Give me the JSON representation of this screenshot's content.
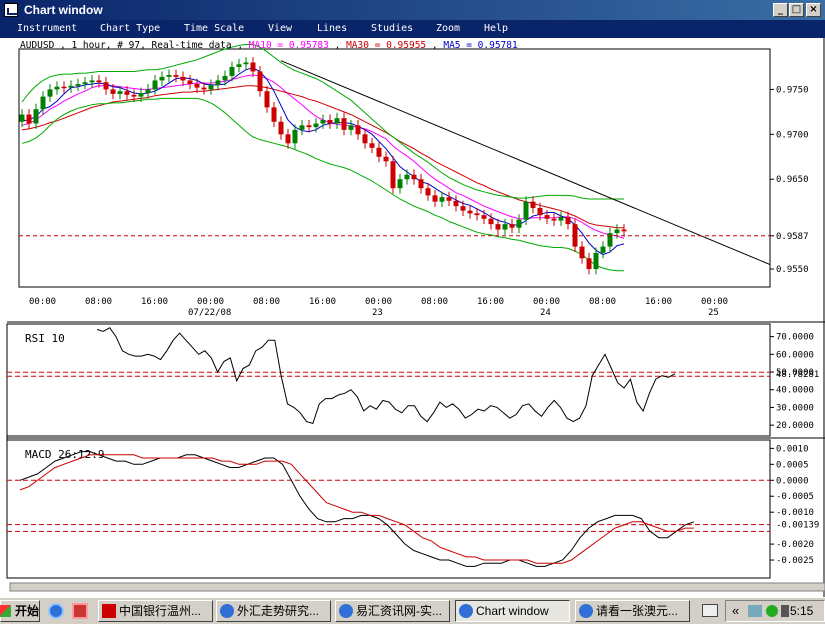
{
  "window": {
    "title": "Chart window"
  },
  "title_buttons": {
    "minimize": "_",
    "maximize": "□",
    "close": "×"
  },
  "menu": [
    "Instrument",
    "Chart Type",
    "Time Scale",
    "View",
    "Lines",
    "Studies",
    "Zoom",
    "Help"
  ],
  "info": {
    "symbol": "AUDUSD , 1 hour, # 97, Real-time data ,",
    "ma10": "MA10 = 0.95783",
    "ma30": "MA30 = 0.95955",
    "ma5": "MA5 = 0.95781",
    "sep": ","
  },
  "colors": {
    "ma10": "#ff00ff",
    "ma30": "#cc0000",
    "ma5": "#0000cc",
    "bollinger": "#00aa00",
    "up": "#008000",
    "down": "#cc0000"
  },
  "time_axis": {
    "labels": [
      "00:00",
      "08:00",
      "16:00",
      "00:00",
      "08:00",
      "16:00",
      "00:00",
      "08:00",
      "16:00",
      "00:00",
      "08:00",
      "16:00",
      "00:00"
    ],
    "dates": [
      "07/22/08",
      "23",
      "24",
      "25"
    ]
  },
  "chart_data": [
    {
      "type": "candlestick",
      "title": "AUDUSD , 1 hour",
      "y_ticks": [
        "0.9750",
        "0.9700",
        "0.9650",
        "0.9550"
      ],
      "ylim": [
        0.953,
        0.9795
      ],
      "current_price": "0.9587",
      "grid": false,
      "closes": [
        0.9722,
        0.9712,
        0.9728,
        0.9742,
        0.975,
        0.9753,
        0.9752,
        0.9754,
        0.9756,
        0.9758,
        0.976,
        0.9758,
        0.975,
        0.9745,
        0.9748,
        0.9744,
        0.9742,
        0.9746,
        0.975,
        0.976,
        0.9764,
        0.9766,
        0.9764,
        0.976,
        0.9756,
        0.9752,
        0.975,
        0.9755,
        0.976,
        0.9765,
        0.9775,
        0.9778,
        0.978,
        0.977,
        0.9748,
        0.973,
        0.9714,
        0.97,
        0.969,
        0.9705,
        0.971,
        0.9708,
        0.9712,
        0.9716,
        0.9712,
        0.9718,
        0.9705,
        0.971,
        0.97,
        0.969,
        0.9685,
        0.9675,
        0.967,
        0.964,
        0.965,
        0.9655,
        0.965,
        0.964,
        0.9632,
        0.9625,
        0.963,
        0.9626,
        0.962,
        0.9615,
        0.9612,
        0.961,
        0.9606,
        0.96,
        0.9594,
        0.96,
        0.9596,
        0.9605,
        0.9625,
        0.9618,
        0.961,
        0.9606,
        0.9604,
        0.9608,
        0.96,
        0.9575,
        0.9562,
        0.955,
        0.9568,
        0.9575,
        0.959,
        0.9594,
        0.9592
      ],
      "series": [
        {
          "name": "MA10",
          "color": "#ff00ff",
          "values": [
            0.971,
            0.9712,
            0.9716,
            0.9722,
            0.9728,
            0.9732,
            0.9737,
            0.9741,
            0.9745,
            0.9748,
            0.9752,
            0.9754,
            0.9754,
            0.9754,
            0.9753,
            0.9752,
            0.9751,
            0.975,
            0.975,
            0.9751,
            0.9752,
            0.9753,
            0.9754,
            0.9755,
            0.9756,
            0.9757,
            0.9757,
            0.9757,
            0.9758,
            0.9759,
            0.9761,
            0.9763,
            0.9765,
            0.9766,
            0.9765,
            0.9762,
            0.9758,
            0.9752,
            0.9745,
            0.9739,
            0.9733,
            0.9726,
            0.972,
            0.9716,
            0.9713,
            0.9711,
            0.971,
            0.9709,
            0.9708,
            0.9706,
            0.9703,
            0.9699,
            0.9695,
            0.9687,
            0.9681,
            0.9676,
            0.967,
            0.9663,
            0.9656,
            0.965,
            0.9645,
            0.964,
            0.9635,
            0.9632,
            0.9628,
            0.9624,
            0.962,
            0.9617,
            0.9614,
            0.9611,
            0.9608,
            0.9606,
            0.9606,
            0.9607,
            0.9607,
            0.9607,
            0.9607,
            0.9608,
            0.9608,
            0.9606,
            0.9602,
            0.9597,
            0.9593,
            0.959,
            0.9588,
            0.9587,
            0.9584
          ]
        },
        {
          "name": "MA30",
          "color": "#cc0000",
          "values": [
            0.9705,
            0.9706,
            0.9708,
            0.971,
            0.9713,
            0.9715,
            0.9718,
            0.9721,
            0.9724,
            0.9727,
            0.973,
            0.9732,
            0.9734,
            0.9736,
            0.9737,
            0.9738,
            0.9739,
            0.974,
            0.9741,
            0.9743,
            0.9744,
            0.9745,
            0.9746,
            0.9747,
            0.9747,
            0.9748,
            0.9748,
            0.9749,
            0.975,
            0.9751,
            0.9752,
            0.9753,
            0.9754,
            0.9754,
            0.9753,
            0.9752,
            0.975,
            0.9748,
            0.9746,
            0.9744,
            0.9742,
            0.9739,
            0.9737,
            0.9734,
            0.9731,
            0.9728,
            0.9725,
            0.9722,
            0.9718,
            0.9714,
            0.971,
            0.9706,
            0.9702,
            0.9697,
            0.9692,
            0.9688,
            0.9684,
            0.9679,
            0.9675,
            0.967,
            0.9666,
            0.9662,
            0.9658,
            0.9654,
            0.965,
            0.9646,
            0.9643,
            0.9639,
            0.9636,
            0.9633,
            0.963,
            0.9627,
            0.9625,
            0.9623,
            0.9621,
            0.9619,
            0.9617,
            0.9615,
            0.9612,
            0.9609,
            0.9605,
            0.9601,
            0.9599,
            0.9598,
            0.9597,
            0.9596,
            0.9596
          ]
        },
        {
          "name": "MA5",
          "color": "#0000cc",
          "values": [
            0.9715,
            0.9716,
            0.972,
            0.9728,
            0.9731,
            0.9737,
            0.9745,
            0.9752,
            0.9753,
            0.9755,
            0.9756,
            0.9757,
            0.9756,
            0.9753,
            0.9752,
            0.9749,
            0.9746,
            0.9745,
            0.9746,
            0.9748,
            0.9752,
            0.9757,
            0.9762,
            0.9763,
            0.9762,
            0.976,
            0.9756,
            0.9755,
            0.9755,
            0.9756,
            0.9761,
            0.9767,
            0.9772,
            0.9774,
            0.977,
            0.9761,
            0.9748,
            0.9732,
            0.9716,
            0.9708,
            0.9704,
            0.9703,
            0.9705,
            0.971,
            0.9712,
            0.9713,
            0.9713,
            0.9712,
            0.9709,
            0.9705,
            0.97,
            0.9692,
            0.9684,
            0.9674,
            0.9664,
            0.9658,
            0.9653,
            0.9647,
            0.9645,
            0.964,
            0.9635,
            0.9631,
            0.9627,
            0.9623,
            0.9621,
            0.9617,
            0.9613,
            0.9608,
            0.9604,
            0.9602,
            0.9599,
            0.9599,
            0.9604,
            0.9609,
            0.9611,
            0.9613,
            0.9613,
            0.9609,
            0.9606,
            0.9599,
            0.959,
            0.9579,
            0.9571,
            0.9566,
            0.9569,
            0.9576,
            0.9578
          ]
        },
        {
          "name": "Bollinger upper",
          "color": "#00aa00",
          "values": [
            0.9736,
            0.9746,
            0.9754,
            0.976,
            0.9764,
            0.9766,
            0.9767,
            0.9767,
            0.9768,
            0.9768,
            0.9769,
            0.977,
            0.977,
            0.977,
            0.977,
            0.977,
            0.977,
            0.9771,
            0.9772,
            0.9772,
            0.9773,
            0.9775,
            0.9777,
            0.9779,
            0.9781,
            0.9783,
            0.9786,
            0.9789,
            0.9792,
            0.9795,
            0.9797,
            0.9799,
            0.98,
            0.98,
            0.9797,
            0.9792,
            0.9786,
            0.978,
            0.9775,
            0.9771,
            0.9768,
            0.9765,
            0.9762,
            0.9758,
            0.9753,
            0.9748,
            0.9743,
            0.9738,
            0.9731,
            0.9724,
            0.9717,
            0.971,
            0.9703,
            0.9697,
            0.9691,
            0.9685,
            0.9679,
            0.9674,
            0.9669,
            0.9663,
            0.9657,
            0.9652,
            0.9648,
            0.9644,
            0.9641,
            0.9638,
            0.9636,
            0.9634,
            0.9632,
            0.9631,
            0.963,
            0.9629,
            0.9629,
            0.963,
            0.9631,
            0.9632,
            0.9632,
            0.9632,
            0.9632,
            0.9631,
            0.9629,
            0.9628,
            0.9628,
            0.9628,
            0.9628,
            0.9628,
            0.9628
          ]
        },
        {
          "name": "Bollinger lower",
          "color": "#00aa00",
          "values": [
            0.969,
            0.9692,
            0.9696,
            0.9702,
            0.971,
            0.9717,
            0.9722,
            0.9726,
            0.9729,
            0.9731,
            0.9733,
            0.9734,
            0.9734,
            0.9735,
            0.9735,
            0.9736,
            0.9737,
            0.9738,
            0.9739,
            0.9739,
            0.974,
            0.974,
            0.974,
            0.974,
            0.974,
            0.974,
            0.9738,
            0.9735,
            0.973,
            0.9724,
            0.9717,
            0.971,
            0.9703,
            0.9697,
            0.9694,
            0.9692,
            0.969,
            0.9688,
            0.9686,
            0.9683,
            0.968,
            0.9677,
            0.9673,
            0.967,
            0.9667,
            0.9665,
            0.9663,
            0.966,
            0.9656,
            0.9652,
            0.9648,
            0.9643,
            0.9638,
            0.9633,
            0.9628,
            0.9624,
            0.962,
            0.9617,
            0.9614,
            0.961,
            0.9607,
            0.9603,
            0.96,
            0.9597,
            0.9594,
            0.9591,
            0.9589,
            0.9588,
            0.9586,
            0.9585,
            0.9583,
            0.9582,
            0.958,
            0.9578,
            0.9576,
            0.9575,
            0.9574,
            0.9574,
            0.9573,
            0.957,
            0.9566,
            0.956,
            0.9554,
            0.9551,
            0.9549,
            0.9548,
            0.9548
          ]
        }
      ]
    },
    {
      "type": "line",
      "title": "RSI 10",
      "y_ticks": [
        "70.0000",
        "60.0000",
        "50.0000",
        "40.0000",
        "30.0000",
        "20.0000"
      ],
      "ylim": [
        15,
        76
      ],
      "current_value": "48.78281",
      "series": [
        {
          "name": "RSI 10",
          "color": "#000000",
          "values": [
            74,
            73,
            75,
            70,
            62,
            60,
            59,
            59,
            60,
            59,
            57,
            62,
            68,
            72,
            68,
            64,
            60,
            62,
            58,
            50,
            56,
            58,
            45,
            52,
            54,
            62,
            64,
            68,
            68,
            48,
            32,
            30,
            27,
            22,
            21,
            32,
            35,
            35,
            37,
            38,
            40,
            36,
            28,
            31,
            29,
            34,
            33,
            29,
            27,
            31,
            31,
            25,
            22,
            27,
            33,
            30,
            32,
            29,
            24,
            26,
            29,
            28,
            31,
            30,
            27,
            24,
            26,
            31,
            32,
            28,
            25,
            30,
            34,
            30,
            24,
            22,
            24,
            31,
            48,
            54,
            60,
            52,
            44,
            41,
            46,
            33,
            28,
            38,
            46,
            48,
            47,
            49
          ]
        }
      ]
    },
    {
      "type": "line",
      "title": "MACD 26:12:9",
      "y_ticks": [
        "0.0010",
        "0.0005",
        "0.0000",
        "-0.0005",
        "-0.0010",
        "-0.0020",
        "-0.0025"
      ],
      "ylim": [
        -0.003,
        0.0012
      ],
      "current_value": "-0.00139",
      "series": [
        {
          "name": "MACD",
          "color": "#000000",
          "values": [
            0.0,
            0.0001,
            0.0002,
            0.0004,
            0.0006,
            0.0007,
            0.0008,
            0.0009,
            0.0009,
            0.0008,
            0.0007,
            0.0006,
            0.0006,
            0.0005,
            0.0005,
            0.0006,
            0.0007,
            0.0007,
            0.0007,
            0.0008,
            0.0008,
            0.0007,
            0.0006,
            0.0005,
            0.0004,
            0.0004,
            0.0005,
            0.0006,
            0.0007,
            0.0007,
            0.0005,
            0.0,
            -0.0005,
            -0.0009,
            -0.0012,
            -0.0013,
            -0.0013,
            -0.0012,
            -0.0012,
            -0.0011,
            -0.0011,
            -0.0012,
            -0.0014,
            -0.0017,
            -0.002,
            -0.0022,
            -0.0023,
            -0.0024,
            -0.0025,
            -0.0025,
            -0.0026,
            -0.0027,
            -0.0027,
            -0.0026,
            -0.0026,
            -0.0026,
            -0.0025,
            -0.0025,
            -0.0026,
            -0.0027,
            -0.0027,
            -0.0026,
            -0.0025,
            -0.0022,
            -0.0018,
            -0.0015,
            -0.0013,
            -0.0012,
            -0.0011,
            -0.0011,
            -0.0011,
            -0.0012,
            -0.0016,
            -0.0018,
            -0.0018,
            -0.0016,
            -0.0014,
            -0.0013
          ]
        },
        {
          "name": "Signal",
          "color": "#cc0000",
          "values": [
            -0.0003,
            -0.0002,
            0.0,
            0.0002,
            0.0004,
            0.0005,
            0.0006,
            0.0007,
            0.0008,
            0.0008,
            0.0008,
            0.0008,
            0.0008,
            0.0008,
            0.0007,
            0.0007,
            0.0007,
            0.0007,
            0.0007,
            0.0007,
            0.0007,
            0.0007,
            0.0007,
            0.0006,
            0.0006,
            0.0005,
            0.0005,
            0.0005,
            0.0006,
            0.0006,
            0.0006,
            0.0005,
            0.0002,
            -0.0001,
            -0.0004,
            -0.0007,
            -0.0008,
            -0.0009,
            -0.001,
            -0.001,
            -0.0011,
            -0.0011,
            -0.0012,
            -0.0013,
            -0.0014,
            -0.0016,
            -0.0018,
            -0.0019,
            -0.0021,
            -0.0022,
            -0.0023,
            -0.0024,
            -0.0024,
            -0.0025,
            -0.0025,
            -0.0025,
            -0.0025,
            -0.0025,
            -0.0025,
            -0.0026,
            -0.0026,
            -0.0026,
            -0.0026,
            -0.0025,
            -0.0023,
            -0.0021,
            -0.0019,
            -0.0017,
            -0.0015,
            -0.0014,
            -0.0013,
            -0.0013,
            -0.0014,
            -0.0015,
            -0.0016,
            -0.0016,
            -0.0015,
            -0.0015
          ]
        }
      ]
    }
  ],
  "taskbar": {
    "start": "开始",
    "items": [
      {
        "label": "中国银行温州..."
      },
      {
        "label": "外汇走势研究..."
      },
      {
        "label": "易汇资讯网-实..."
      },
      {
        "label": "Chart window"
      },
      {
        "label": "请看一张澳元..."
      }
    ],
    "clock": "5:15",
    "chevron": "«"
  }
}
